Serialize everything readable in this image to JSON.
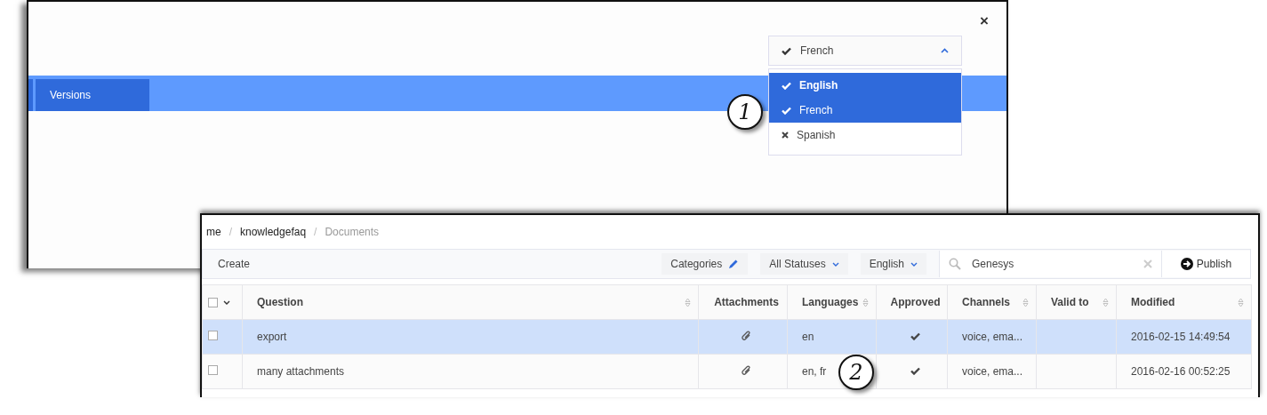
{
  "dialog": {
    "close": "×",
    "tabs": [
      {
        "label": "Versions",
        "selected": true
      }
    ],
    "language_select": {
      "value": "French",
      "expanded": true,
      "options": [
        {
          "label": "English",
          "checked": true,
          "selected": true,
          "focused": true
        },
        {
          "label": "French",
          "checked": true,
          "selected": true,
          "focused": false
        },
        {
          "label": "Spanish",
          "checked": false,
          "selected": false,
          "focused": false
        }
      ]
    }
  },
  "documents": {
    "breadcrumb": {
      "separator": "/",
      "items": [
        "me",
        "knowledgefaq",
        "Documents"
      ]
    },
    "toolbar": {
      "create": "Create",
      "filters": [
        {
          "label": "Categories",
          "kind": "edit"
        },
        {
          "label": "All Statuses",
          "kind": "dropdown"
        },
        {
          "label": "English",
          "kind": "dropdown"
        }
      ],
      "search": {
        "value": "Genesys"
      },
      "publish": "Publish"
    },
    "table": {
      "select_all": {
        "checked": false
      },
      "columns": [
        {
          "label": "Question",
          "sortable": true
        },
        {
          "label": "Attachments",
          "sortable": false
        },
        {
          "label": "Languages",
          "sortable": true
        },
        {
          "label": "Approved",
          "sortable": false
        },
        {
          "label": "Channels",
          "sortable": true
        },
        {
          "label": "Valid to",
          "sortable": true
        },
        {
          "label": "Modified",
          "sortable": true
        }
      ],
      "rows": [
        {
          "selected": true,
          "checked": false,
          "question": "export",
          "attachments": true,
          "languages": "en",
          "approved": true,
          "channels": "voice, ema...",
          "modified": "2016-02-15 14:49:54"
        },
        {
          "selected": false,
          "checked": false,
          "question": "many attachments",
          "attachments": true,
          "languages": "en, fr",
          "approved": true,
          "channels": "voice, ema...",
          "modified": "2016-02-16 00:52:25"
        }
      ]
    }
  },
  "callouts": [
    "1",
    "2"
  ]
}
